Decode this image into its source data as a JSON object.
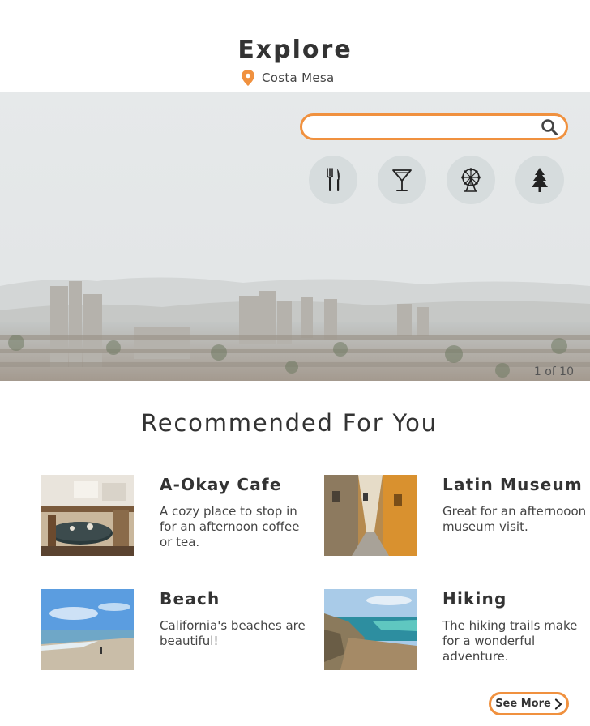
{
  "header": {
    "title": "Explore",
    "location": "Costa Mesa",
    "location_icon": "map-pin-icon"
  },
  "search": {
    "placeholder": "",
    "value": "",
    "icon": "search-icon"
  },
  "categories": [
    {
      "icon": "fork-knife-icon"
    },
    {
      "icon": "cocktail-glass-icon"
    },
    {
      "icon": "ferris-wheel-icon"
    },
    {
      "icon": "pine-tree-icon"
    }
  ],
  "hero": {
    "counter": "1 of 10"
  },
  "recommended": {
    "title": "Recommended For You",
    "items": [
      {
        "name": "A-Okay Cafe",
        "description": "A cozy place to stop in for an afternoon coffee or tea."
      },
      {
        "name": "Latin Museum",
        "description": "Great for an afternooon museum visit."
      },
      {
        "name": "Beach",
        "description": "California's beaches are beautiful!"
      },
      {
        "name": "Hiking",
        "description": "The hiking trails make for a wonderful adventure."
      }
    ],
    "see_more": "See More"
  },
  "colors": {
    "accent": "#f0913f",
    "category_bg": "#d6dcdd",
    "text": "#333333"
  }
}
